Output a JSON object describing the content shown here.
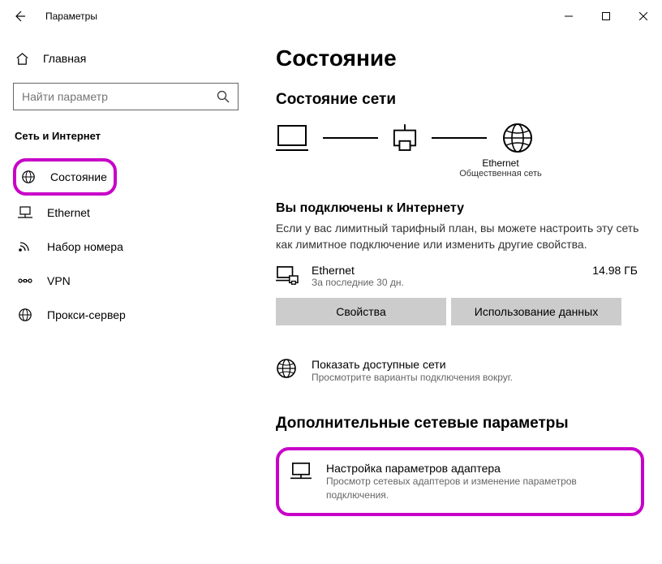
{
  "titlebar": {
    "title": "Параметры"
  },
  "sidebar": {
    "home": "Главная",
    "search_placeholder": "Найти параметр",
    "category": "Сеть и Интернет",
    "items": [
      {
        "label": "Состояние",
        "icon": "status-icon"
      },
      {
        "label": "Ethernet",
        "icon": "ethernet-icon"
      },
      {
        "label": "Набор номера",
        "icon": "dialup-icon"
      },
      {
        "label": "VPN",
        "icon": "vpn-icon"
      },
      {
        "label": "Прокси-сервер",
        "icon": "proxy-icon"
      }
    ]
  },
  "main": {
    "page_title": "Состояние",
    "network_status_title": "Состояние сети",
    "diagram": {
      "name": "Ethernet",
      "sub": "Общественная сеть"
    },
    "connected": {
      "title": "Вы подключены к Интернету",
      "desc": "Если у вас лимитный тарифный план, вы можете настроить эту сеть как лимитное подключение или изменить другие свойства."
    },
    "adapter": {
      "name": "Ethernet",
      "sub": "За последние 30 дн.",
      "size": "14.98 ГБ"
    },
    "btn_properties": "Свойства",
    "btn_data_usage": "Использование данных",
    "show_available": {
      "title": "Показать доступные сети",
      "sub": "Просмотрите варианты подключения вокруг."
    },
    "advanced_title": "Дополнительные сетевые параметры",
    "adapter_settings": {
      "title": "Настройка параметров адаптера",
      "sub": "Просмотр сетевых адаптеров и изменение параметров подключения."
    }
  }
}
